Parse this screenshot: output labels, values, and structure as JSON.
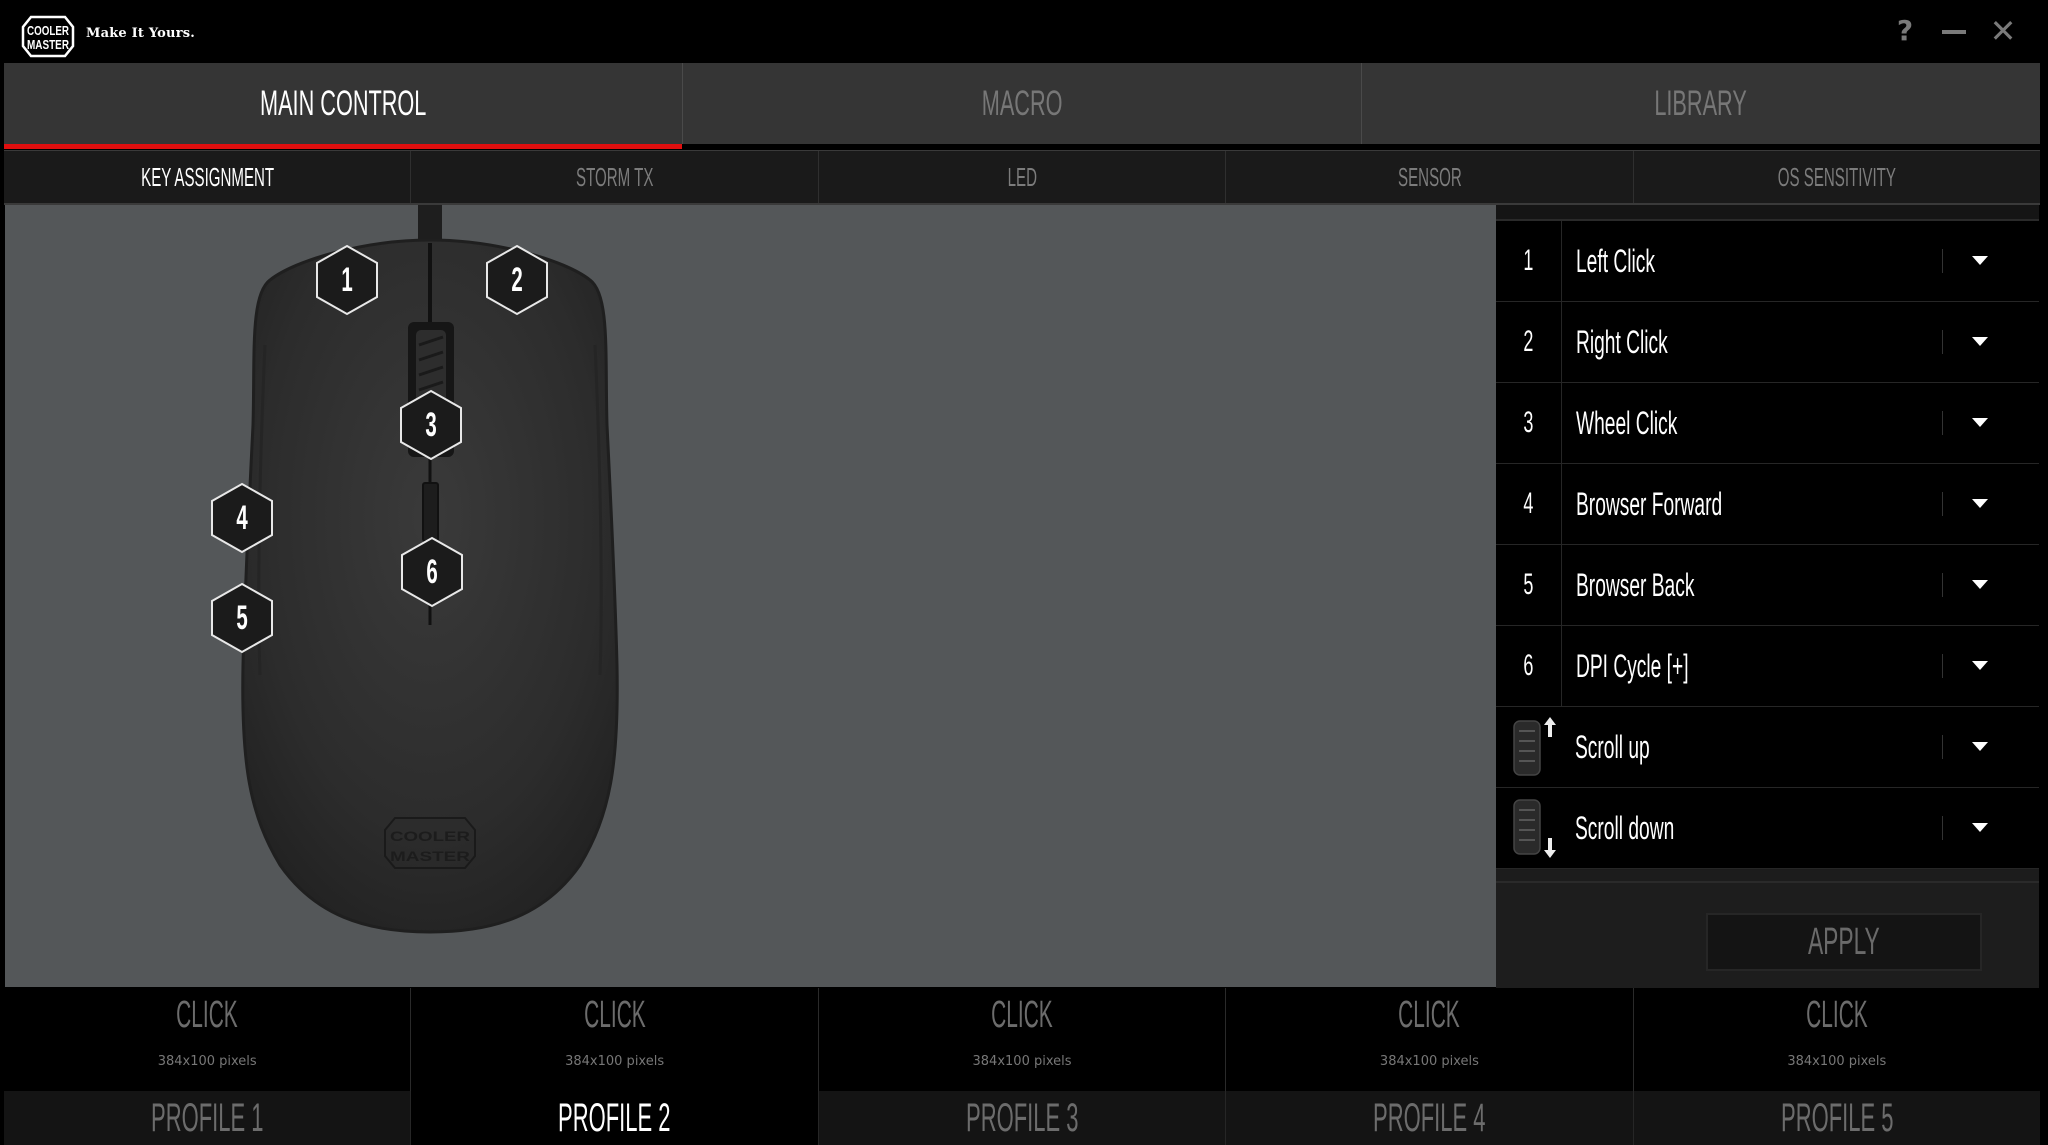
{
  "app": {
    "brand": "COOLER MASTER",
    "tagline": "Make It Yours.",
    "window_controls": {
      "help": "?",
      "minimize": "",
      "close": "✕"
    }
  },
  "main_tabs": [
    {
      "label": "MAIN CONTROL",
      "active": true
    },
    {
      "label": "MACRO",
      "active": false
    },
    {
      "label": "LIBRARY",
      "active": false
    }
  ],
  "sub_tabs": [
    {
      "label": "KEY ASSIGNMENT",
      "active": true
    },
    {
      "label": "STORM TX",
      "active": false
    },
    {
      "label": "LED",
      "active": false
    },
    {
      "label": "SENSOR",
      "active": false
    },
    {
      "label": "OS SENSITIVITY",
      "active": false
    }
  ],
  "mouse_badges": [
    "1",
    "2",
    "3",
    "4",
    "5",
    "6"
  ],
  "mouse_logo": "COOLER MASTER",
  "assignments": [
    {
      "key": "1",
      "action": "Left Click",
      "icon": null
    },
    {
      "key": "2",
      "action": "Right Click",
      "icon": null
    },
    {
      "key": "3",
      "action": "Wheel Click",
      "icon": null
    },
    {
      "key": "4",
      "action": "Browser Forward",
      "icon": null
    },
    {
      "key": "5",
      "action": "Browser Back",
      "icon": null
    },
    {
      "key": "6",
      "action": "DPI Cycle [+]",
      "icon": null
    },
    {
      "key": "",
      "action": "Scroll up",
      "icon": "scroll-up-icon"
    },
    {
      "key": "",
      "action": "Scroll down",
      "icon": "scroll-down-icon"
    }
  ],
  "apply_label": "APPLY",
  "profile_cards": [
    {
      "title": "CLICK",
      "subtitle": "384x100 pixels"
    },
    {
      "title": "CLICK",
      "subtitle": "384x100 pixels"
    },
    {
      "title": "CLICK",
      "subtitle": "384x100 pixels"
    },
    {
      "title": "CLICK",
      "subtitle": "384x100 pixels"
    },
    {
      "title": "CLICK",
      "subtitle": "384x100 pixels"
    }
  ],
  "profiles": [
    {
      "label": "PROFILE 1",
      "active": false
    },
    {
      "label": "PROFILE 2",
      "active": true
    },
    {
      "label": "PROFILE 3",
      "active": false
    },
    {
      "label": "PROFILE 4",
      "active": false
    },
    {
      "label": "PROFILE 5",
      "active": false
    }
  ],
  "colors": {
    "accent": "#e00f0f",
    "canvas_bg": "#545759",
    "inactive_text": "#777777"
  }
}
